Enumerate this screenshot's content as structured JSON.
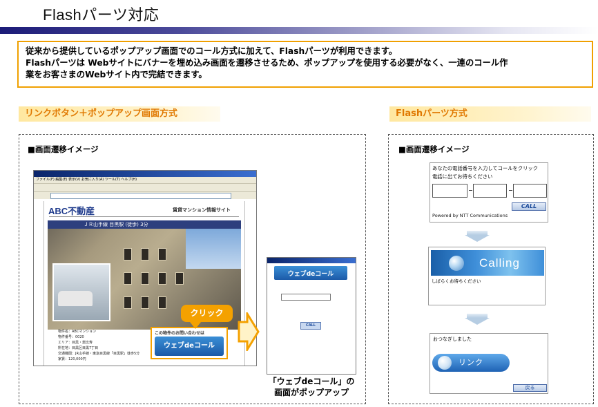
{
  "title": "Flashパーツ対応",
  "intro": {
    "line1": "従来から提供しているポップアップ画面でのコール方式に加えて、Flashパーツが利用できます。",
    "line2": "Flashパーツは Webサイトにバナーを埋め込み画面を遷移させるため、ポップアップを使用する必要がなく、一連のコール作",
    "line3": "業をお客さまのWebサイト内で完結できます。"
  },
  "left_section": {
    "header": "リンクボタン＋ポップアップ画面方式",
    "image_label": "■画面遷移イメージ",
    "browser_menu": "ファイル(F)  編集(E)  表示(V)  お気に入り(A)  ツール(T)  ヘルプ(H)",
    "site_logo": "ABC不動産",
    "site_subtitle": "賃貸マンション情報サイト",
    "station": "ＪＲ山手線 目黒駅 (徒歩) 3分",
    "info_lines": [
      "物件名：ABCマンション",
      "物件番号：0020",
      "エリア：目黒・恵比寿",
      "所在地：目黒区目黒7丁目",
      "交通機関：JR山手線・東急目黒線「目黒駅」徒歩5分",
      "家賃：120,000円"
    ],
    "contact_text": "この物件のお問い合わせは",
    "webcall_button": "ウェブdeコール",
    "click_label": "クリック",
    "popup_logo": "ウェブdeコール",
    "popup_call": "CALL",
    "caption_line1": "「ウェブdeコール」の",
    "caption_line2": "画面がポップアップ"
  },
  "right_section": {
    "header": "Flashパーツ方式",
    "image_label": "■画面遷移イメージ",
    "step1": {
      "instruction_line1": "あなたの電話番号を入力してコールをクリック",
      "instruction_line2": "電話に出てお待ちください",
      "call_button": "CALL",
      "powered": "Powered by NTT Communications"
    },
    "step2": {
      "calling": "Calling",
      "wait": "しばらくお待ちください"
    },
    "step3": {
      "connected": "おつなぎしました",
      "link_button": "リンク",
      "back_button": "戻る"
    }
  },
  "colors": {
    "accent_orange": "#f0a000",
    "header_orange": "#e07800",
    "title_rule": "#1c1b78"
  }
}
